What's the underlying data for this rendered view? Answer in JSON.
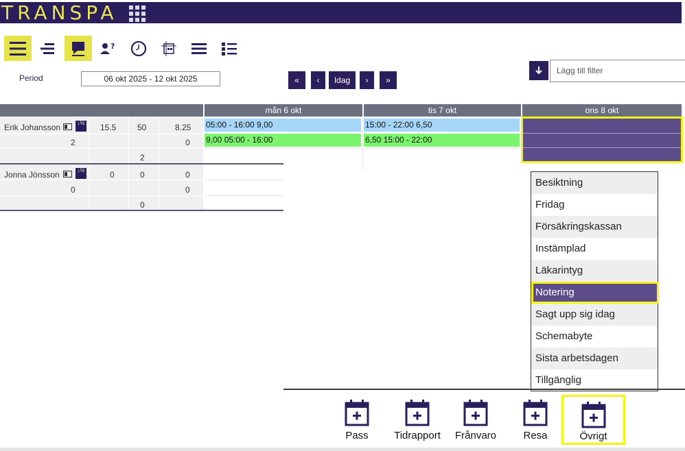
{
  "app": {
    "logo_text": "TRANSPA"
  },
  "toolbar": {
    "icons": [
      "menu-icon",
      "list-align-icon",
      "comment-icon",
      "user-question-icon",
      "clock-icon",
      "crosshair-grid-icon",
      "lines-icon",
      "bullet-list-icon"
    ]
  },
  "period": {
    "label": "Period",
    "value": "06 okt 2025 - 12 okt 2025"
  },
  "nav": {
    "first": "«",
    "prev": "‹",
    "today": "Idag",
    "next": "›",
    "last": "»"
  },
  "filter": {
    "placeholder": "Lägg till filter"
  },
  "days": [
    "mån 6 okt",
    "tis 7 okt",
    "ons 8 okt"
  ],
  "employees": [
    {
      "name": "Erik Johansson",
      "row1": [
        "15.5",
        "50",
        "8.25"
      ],
      "row2": [
        "2",
        "0"
      ],
      "row3": [
        "2"
      ],
      "shifts": {
        "mon_top": "05:00 - 16:00 9,00",
        "mon_bottom": "9,00 05:00 - 16:00",
        "tue_top": "15:00 - 22:00 6,50",
        "tue_bottom": "6,50 15:00 - 22:00"
      }
    },
    {
      "name": "Jonna Jönsson",
      "row1": [
        "0",
        "0",
        "0"
      ],
      "row2": [
        "0",
        "0"
      ],
      "row3": [
        "0"
      ]
    }
  ],
  "menu": {
    "items": [
      "Besiktning",
      "Fridag",
      "Försäkringskassan",
      "Instämplad",
      "Läkarintyg",
      "Notering",
      "Sagt upp sig idag",
      "Schemabyte",
      "Sista arbetsdagen",
      "Tillgänglig"
    ],
    "selected": "Notering"
  },
  "bottom": {
    "pass": "Pass",
    "tidrapport": "Tidrapport",
    "franvaro": "Frånvaro",
    "resa": "Resa",
    "ovrigt": "Övrigt"
  },
  "colors": {
    "brand": "#2a1e5c",
    "highlight": "#f5f514",
    "shift_blue": "#a5d6f7",
    "shift_green": "#7cf46e",
    "selected": "#5d4c8a"
  }
}
